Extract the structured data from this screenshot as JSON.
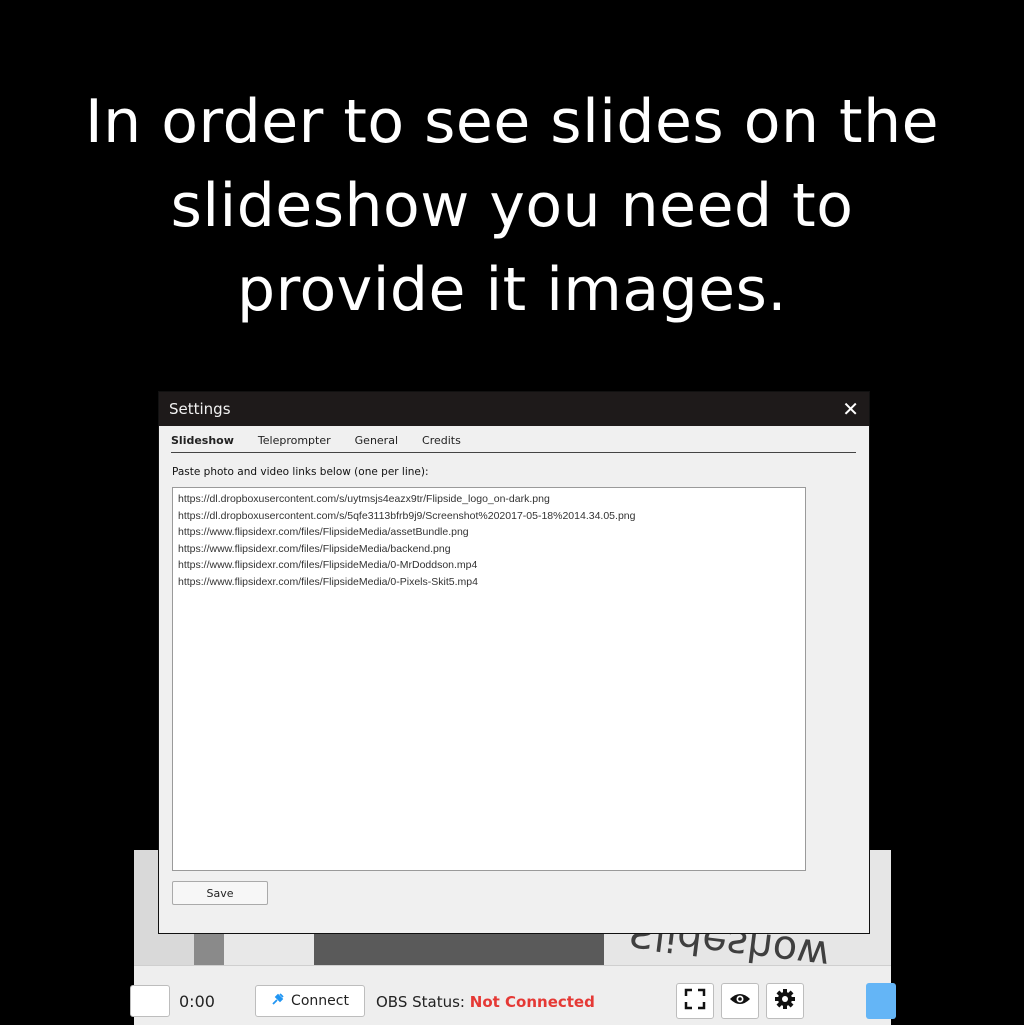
{
  "heading": {
    "line1": "In order to see slides on the",
    "line2": "slideshow you need to",
    "line3": "provide it images."
  },
  "dialog": {
    "title": "Settings",
    "close_icon": "close-icon",
    "tabs": [
      {
        "label": "Slideshow",
        "active": true
      },
      {
        "label": "Teleprompter",
        "active": false
      },
      {
        "label": "General",
        "active": false
      },
      {
        "label": "Credits",
        "active": false
      }
    ],
    "links_label": "Paste photo and video links below (one per line):",
    "links": [
      "https://dl.dropboxusercontent.com/s/uytmsjs4eazx9tr/Flipside_logo_on-dark.png",
      "https://dl.dropboxusercontent.com/s/5qfe3113bfrb9j9/Screenshot%202017-05-18%2014.34.05.png",
      "https://www.flipsidexr.com/files/FlipsideMedia/assetBundle.png",
      "https://www.flipsidexr.com/files/FlipsideMedia/backend.png",
      "https://www.flipsidexr.com/files/FlipsideMedia/0-MrDoddson.mp4",
      "https://www.flipsidexr.com/files/FlipsideMedia/0-Pixels-Skit5.mp4"
    ],
    "save_label": "Save"
  },
  "scene": {
    "text": "Slideshow"
  },
  "toolbar": {
    "time": "0:00",
    "connect_label": "Connect",
    "connect_icon": "plug-icon",
    "obs_label": "OBS Status:",
    "obs_status": "Not Connected",
    "obs_status_color": "#e53935",
    "icons": [
      "fullscreen-icon",
      "eye-icon",
      "gear-icon"
    ]
  }
}
